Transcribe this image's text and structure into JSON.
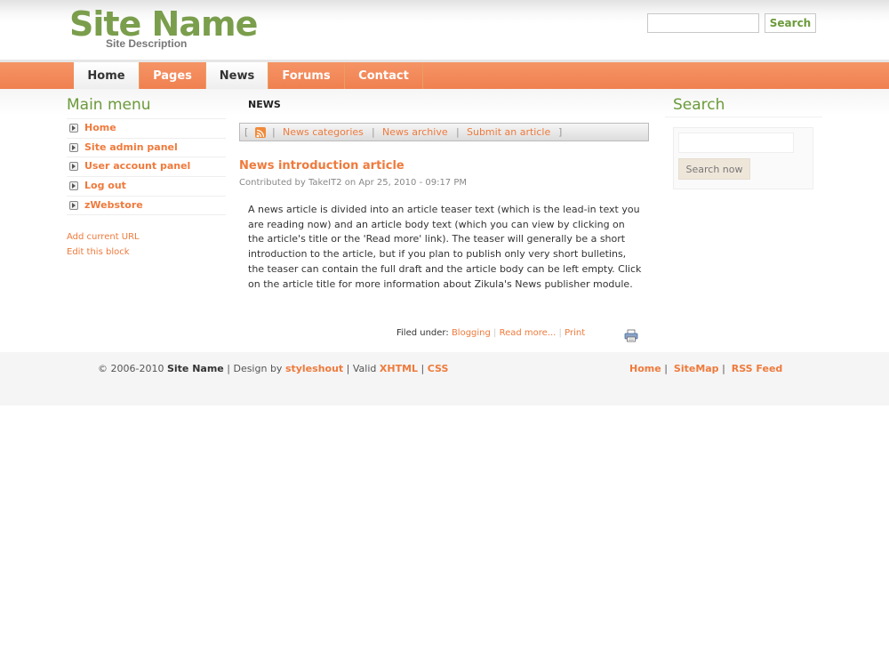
{
  "header": {
    "site_name": "Site Name",
    "site_description": "Site Description",
    "search_button": "Search",
    "search_value": ""
  },
  "nav": {
    "tabs": [
      {
        "label": "Home",
        "active": true
      },
      {
        "label": "Pages",
        "active": false
      },
      {
        "label": "News",
        "active": true
      },
      {
        "label": "Forums",
        "active": false
      },
      {
        "label": "Contact",
        "active": false
      }
    ]
  },
  "left": {
    "title": "Main menu",
    "menu": [
      "Home",
      "Site admin panel",
      "User account panel",
      "Log out",
      "zWebstore"
    ],
    "add_url": "Add current URL",
    "edit_block": "Edit this block"
  },
  "main": {
    "heading": "NEWS",
    "toolbar": {
      "open_bracket": "[",
      "close_bracket": "]",
      "sep": "|",
      "rss_icon": "rss-icon",
      "links": [
        "News categories",
        "News archive",
        "Submit an article"
      ]
    },
    "article": {
      "title": "News introduction article",
      "meta": "Contributed by TakeIT2 on Apr 25, 2010 - 09:17 PM",
      "body": "A news article is divided into an article teaser text (which is the lead-in text you are reading now) and an article body text (which you can view by clicking on the article's title or the 'Read more' link). The teaser will generally be a short introduction to the article, but if you plan to publish only very short bulletins, the teaser can contain the full draft and the article body can be left empty. Click on the article title for more information about Zikula's News publisher module.",
      "filed_under_label": "Filed under:",
      "category": "Blogging",
      "read_more": "Read more...",
      "print": "Print",
      "print_icon": "printer-icon"
    }
  },
  "right": {
    "title": "Search",
    "search_value": "",
    "search_button": "Search now"
  },
  "footer": {
    "copyright": "© 2006-2010",
    "site": "Site Name",
    "design_by": "| Design by",
    "designer": "styleshout",
    "valid": "| Valid",
    "xhtml": "XHTML",
    "pipe": "|",
    "css": "CSS",
    "links": [
      "Home",
      "SiteMap",
      "RSS Feed"
    ]
  },
  "colors": {
    "brand_green": "#7a9e4c",
    "accent_orange": "#ef7a3c",
    "nav_orange": "#f08050"
  }
}
